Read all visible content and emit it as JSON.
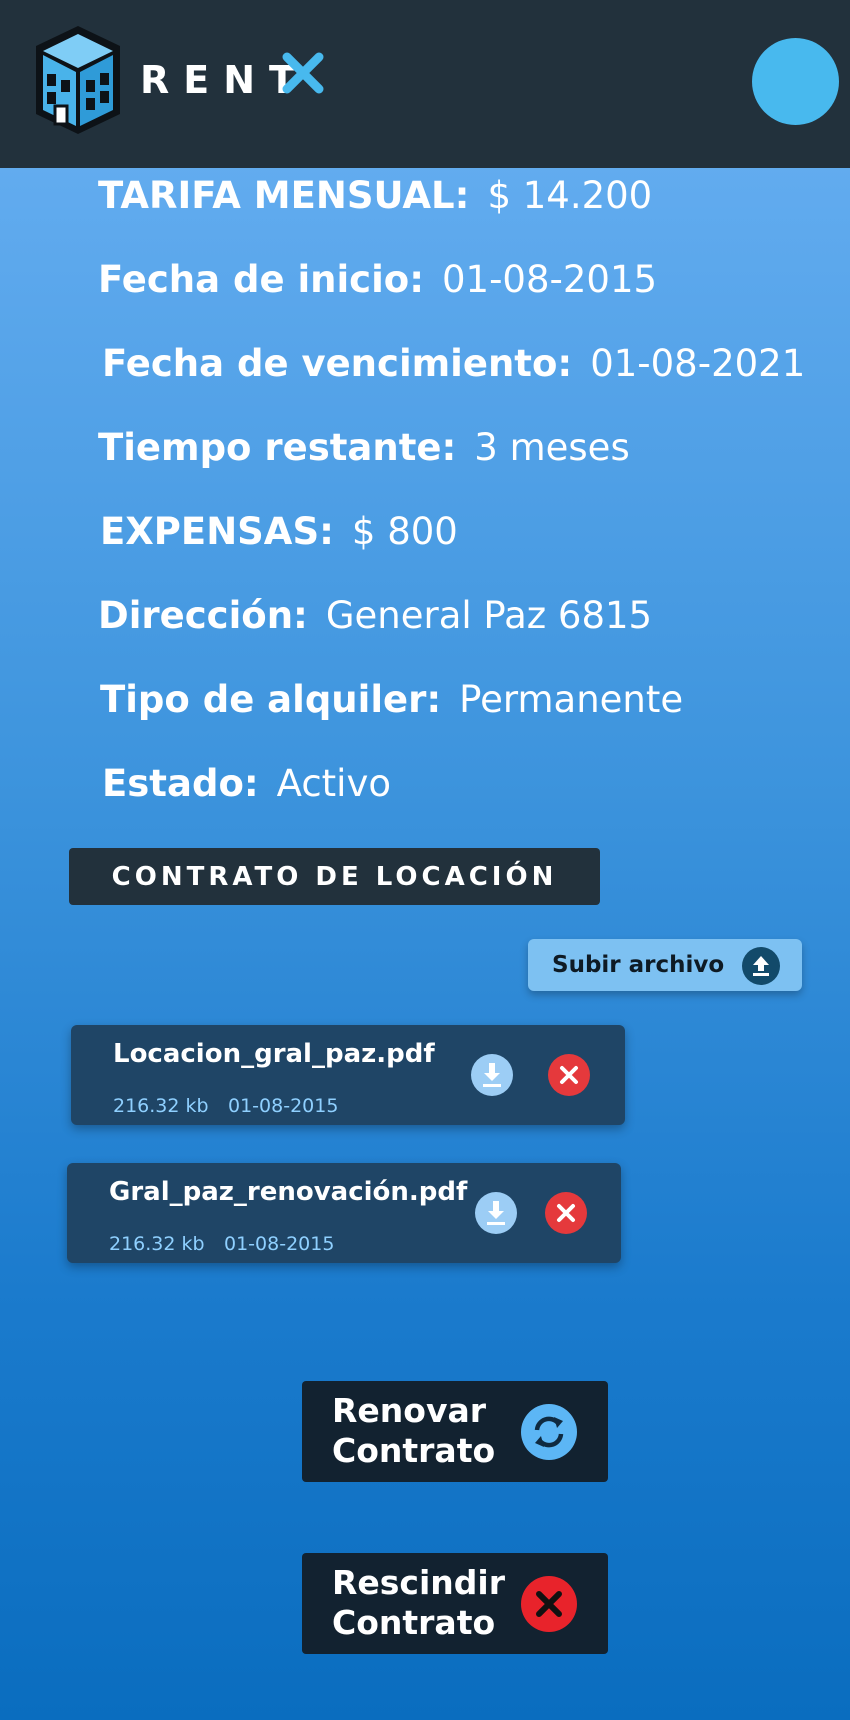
{
  "app": {
    "brand": "RENT",
    "brand_icon": "building-icon",
    "brand_mark_icon": "x-mark-icon"
  },
  "contract": {
    "fields": [
      {
        "label": "TARIFA MENSUAL:",
        "value": "$ 14.200"
      },
      {
        "label": "Fecha de inicio:",
        "value": "01-08-2015"
      },
      {
        "label": "Fecha de vencimiento:",
        "value": "01-08-2021"
      },
      {
        "label": "Tiempo restante:",
        "value": "3 meses"
      },
      {
        "label": "EXPENSAS:",
        "value": "$ 800"
      },
      {
        "label": "Dirección:",
        "value": "General Paz 6815"
      },
      {
        "label": "Tipo de alquiler:",
        "value": "Permanente"
      },
      {
        "label": "Estado:",
        "value": "Activo"
      }
    ]
  },
  "documents": {
    "section_title": "CONTRATO DE LOCACIÓN",
    "upload_label": "Subir archivo",
    "files": [
      {
        "name": "Locacion_gral_paz.pdf",
        "size": "216.32 kb",
        "date": "01-08-2015"
      },
      {
        "name": "Gral_paz_renovación.pdf",
        "size": "216.32 kb",
        "date": "01-08-2015"
      }
    ]
  },
  "actions": {
    "renew_label": "Renovar\nContrato",
    "cancel_label": "Rescindir\nContrato"
  },
  "colors": {
    "header_bg": "#22313c",
    "accent_blue": "#48b9ee",
    "danger_red": "#e5393c",
    "card_bg": "#1f4566"
  }
}
